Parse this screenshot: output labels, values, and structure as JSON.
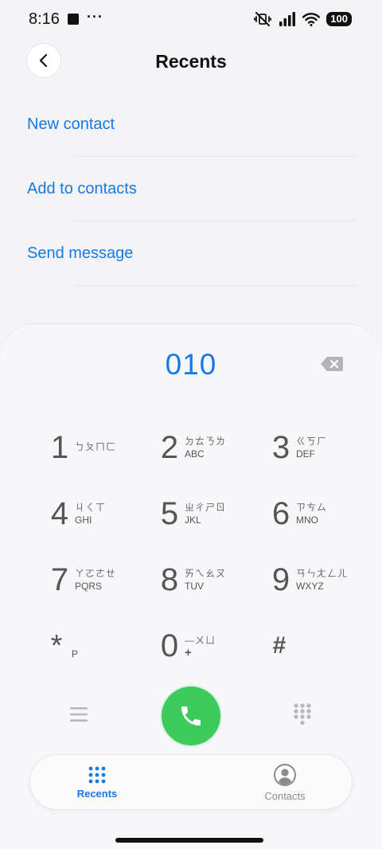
{
  "status_bar": {
    "time": "8:16",
    "dots": "···",
    "battery": "100"
  },
  "header": {
    "title": "Recents"
  },
  "actions": [
    {
      "label": "New contact"
    },
    {
      "label": "Add to contacts"
    },
    {
      "label": "Send message"
    }
  ],
  "dialer": {
    "number": "010"
  },
  "keypad": [
    {
      "digit": "1",
      "zhuyin": "ㄅㄆㄇㄈ",
      "letters": ""
    },
    {
      "digit": "2",
      "zhuyin": "ㄉㄊㄋㄌ",
      "letters": "ABC"
    },
    {
      "digit": "3",
      "zhuyin": "ㄍㄎㄏ",
      "letters": "DEF"
    },
    {
      "digit": "4",
      "zhuyin": "ㄐㄑㄒ",
      "letters": "GHI"
    },
    {
      "digit": "5",
      "zhuyin": "ㄓㄔㄕㄖ",
      "letters": "JKL"
    },
    {
      "digit": "6",
      "zhuyin": "ㄗㄘㄙ",
      "letters": "MNO"
    },
    {
      "digit": "7",
      "zhuyin": "ㄚㄛㄜㄝ",
      "letters": "PQRS"
    },
    {
      "digit": "8",
      "zhuyin": "ㄞㄟㄠㄡ",
      "letters": "TUV"
    },
    {
      "digit": "9",
      "zhuyin": "ㄢㄣㄤㄥㄦ",
      "letters": "WXYZ"
    },
    {
      "digit": "*",
      "zhuyin": "",
      "letters": "P"
    },
    {
      "digit": "0",
      "zhuyin": "—ㄨㄩ",
      "letters": "+"
    },
    {
      "digit": "#",
      "zhuyin": "",
      "letters": ""
    }
  ],
  "tabs": [
    {
      "label": "Recents",
      "icon": "keypad-grid-icon",
      "active": true
    },
    {
      "label": "Contacts",
      "icon": "person-circle-icon",
      "active": false
    }
  ],
  "colors": {
    "accent": "#1579e8",
    "call": "#3ecb5d",
    "background": "#f4f4f7"
  }
}
